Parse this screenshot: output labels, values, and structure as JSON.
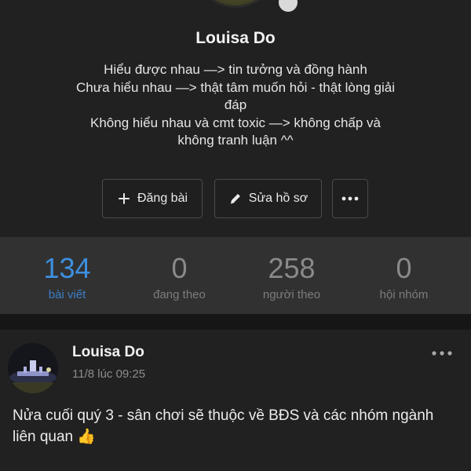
{
  "profile": {
    "name": "Louisa Do",
    "bio_lines": [
      "Hiểu được nhau —> tin tưởng và đồng hành",
      "Chưa hiểu nhau —> thật tâm muốn hỏi - thật lòng giải",
      "đáp",
      "Không hiểu nhau và cmt toxic —> không chấp và",
      "không tranh luận ^^"
    ]
  },
  "actions": {
    "post_label": "Đăng bài",
    "edit_label": "Sửa hồ sơ"
  },
  "stats": [
    {
      "value": "134",
      "label": "bài viết"
    },
    {
      "value": "0",
      "label": "đang theo"
    },
    {
      "value": "258",
      "label": "người theo"
    },
    {
      "value": "0",
      "label": "hội nhóm"
    }
  ],
  "post": {
    "author": "Louisa Do",
    "time": "11/8 lúc 09:25",
    "text": "Nửa cuối quý 3 - sân chơi sẽ thuộc về BĐS và các nhóm ngành liên quan 👍"
  },
  "icons": {
    "post": "plus-icon",
    "edit": "pencil-icon",
    "more": "more-horizontal-icon"
  },
  "colors": {
    "background": "#212121",
    "stats_background": "#313131",
    "accent": "#3d8fe0"
  }
}
